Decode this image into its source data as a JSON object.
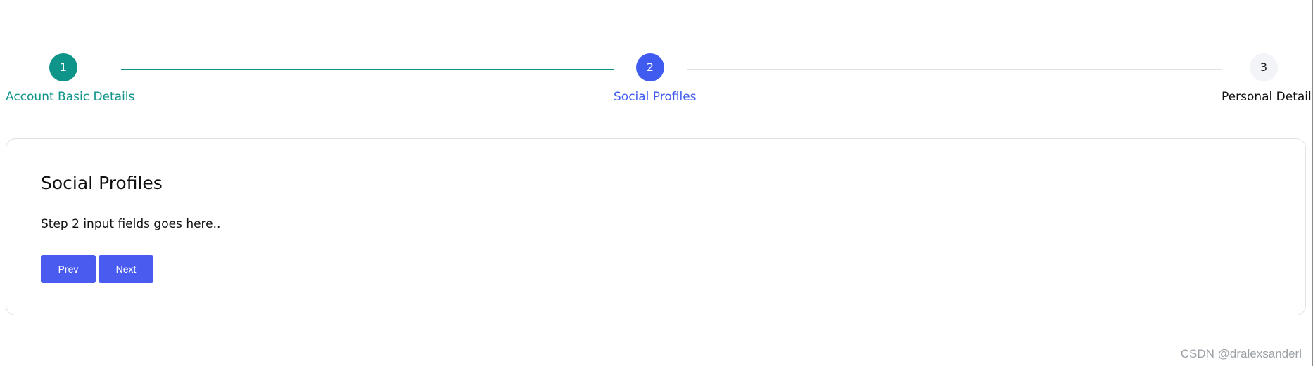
{
  "stepper": {
    "steps": [
      {
        "number": "1",
        "label": "Account Basic Details",
        "state": "completed",
        "color": "#0e9488"
      },
      {
        "number": "2",
        "label": "Social Profiles",
        "state": "active",
        "color": "#3f5bf0"
      },
      {
        "number": "3",
        "label": "Personal Details",
        "state": "upcoming",
        "color": "#f3f4f8"
      }
    ],
    "connector_colors": [
      "#0e9488",
      "#dfe2e6"
    ]
  },
  "card": {
    "title": "Social Profiles",
    "text": "Step 2 input fields goes here..",
    "prev_label": "Prev",
    "next_label": "Next",
    "button_color": "#4a5cf0"
  },
  "watermark": "CSDN @dralexsanderl"
}
